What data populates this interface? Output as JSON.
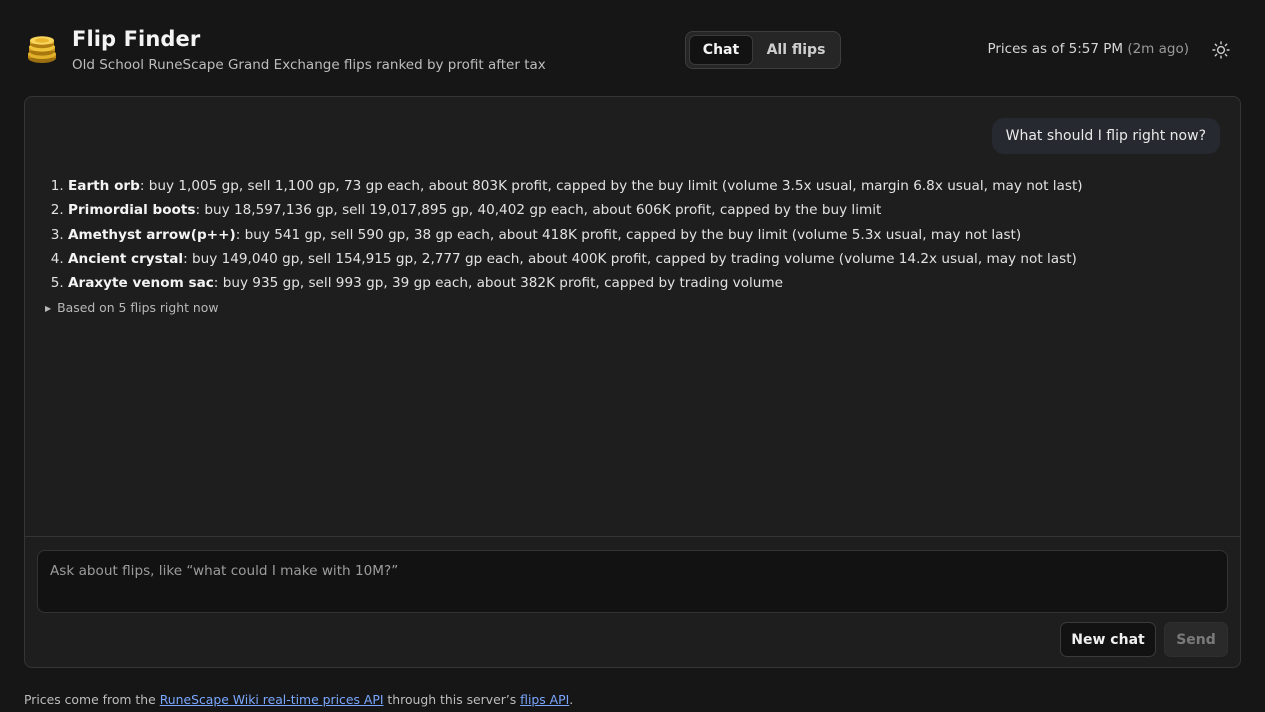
{
  "header": {
    "logo_icon": "gold-coins-icon",
    "title": "Flip Finder",
    "subtitle": "Old School RuneScape Grand Exchange flips ranked by profit after tax",
    "tabs": [
      {
        "label": "Chat",
        "active": true
      },
      {
        "label": "All flips",
        "active": false
      }
    ],
    "prices_status": "Prices as of 5:57 PM",
    "prices_ago": "(2m ago)",
    "theme_icon": "sun-icon"
  },
  "chat": {
    "user_message": "What should I flip right now?",
    "answer_items": [
      {
        "name": "Earth orb",
        "detail": ": buy 1,005 gp, sell 1,100 gp, 73 gp each, about 803K profit, capped by the buy limit (volume 3.5x usual, margin 6.8x usual, may not last)"
      },
      {
        "name": "Primordial boots",
        "detail": ": buy 18,597,136 gp, sell 19,017,895 gp, 40,402 gp each, about 606K profit, capped by the buy limit"
      },
      {
        "name": "Amethyst arrow(p++)",
        "detail": ": buy 541 gp, sell 590 gp, 38 gp each, about 418K profit, capped by the buy limit (volume 5.3x usual, may not last)"
      },
      {
        "name": "Ancient crystal",
        "detail": ": buy 149,040 gp, sell 154,915 gp, 2,777 gp each, about 400K profit, capped by trading volume (volume 14.2x usual, may not last)"
      },
      {
        "name": "Araxyte venom sac",
        "detail": ": buy 935 gp, sell 993 gp, 39 gp each, about 382K profit, capped by trading volume"
      }
    ],
    "details_label": "Based on 5 flips right now"
  },
  "composer": {
    "placeholder": "Ask about flips, like “what could I make with 10M?”",
    "value": "",
    "new_chat_label": "New chat",
    "send_label": "Send"
  },
  "footer": {
    "text_before": "Prices come from the ",
    "link1": "RuneScape Wiki real-time prices API",
    "text_middle": " through this server’s ",
    "link2": "flips API",
    "text_after": "."
  },
  "colors": {
    "background": "#161616",
    "panel": "#1e1e1e",
    "link": "#7aa7ff",
    "gold": "#d8a623"
  }
}
